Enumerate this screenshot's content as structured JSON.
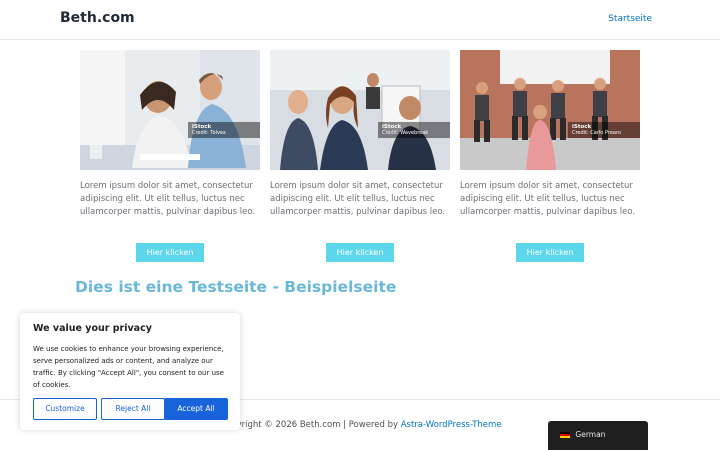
{
  "header": {
    "site_title": "Beth.com",
    "nav": [
      "Startseite"
    ]
  },
  "cards": [
    {
      "text": "Lorem ipsum dolor sit amet, consectetur adipiscing elit. Ut elit tellus, luctus nec ullamcorper mattis, pulvinar dapibus leo.",
      "button": "Hier klicken",
      "watermark": "iStock",
      "credit": "Credit: Tolvex"
    },
    {
      "text": "Lorem ipsum dolor sit amet, consectetur adipiscing elit. Ut elit tellus, luctus nec ullamcorper mattis, pulvinar dapibus leo.",
      "button": "Hier klicken",
      "watermark": "iStock",
      "credit": "Credit: Wavebreak"
    },
    {
      "text": "Lorem ipsum dolor sit amet, consectetur adipiscing elit. Ut elit tellus, luctus nec ullamcorper mattis, pulvinar dapibus leo.",
      "button": "Hier klicken",
      "watermark": "iStock",
      "credit": "Credit: Carlo Prearo"
    }
  ],
  "page_heading": "Dies ist eine Testseite - Beispielseite",
  "footer": {
    "text": "opyright © 2026 Beth.com | Powered by ",
    "link": "Astra-WordPress-Theme"
  },
  "cookie": {
    "title": "We value your privacy",
    "text": "We use cookies to enhance your browsing experience, serve personalized ads or content, and analyze our traffic. By clicking \"Accept All\", you consent to our use of cookies.",
    "buttons": {
      "customize": "Customize",
      "reject": "Reject All",
      "accept": "Accept All"
    }
  },
  "language": {
    "label": "German",
    "flag_icon": "germany-flag-icon"
  },
  "colors": {
    "accent": "#5cd6ea",
    "link": "#0274be",
    "heading": "#6ab8d8",
    "cookie_primary": "#1863dc"
  }
}
